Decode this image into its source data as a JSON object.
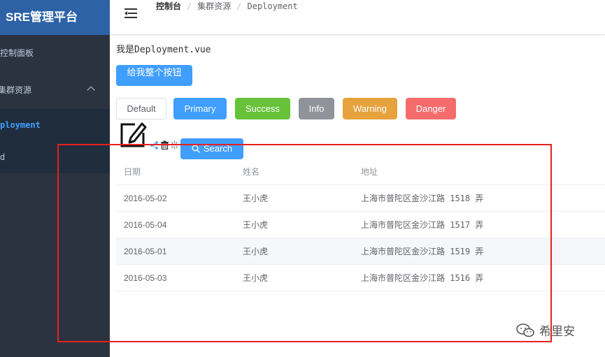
{
  "sidebar": {
    "logo": "SRE管理平台",
    "items": [
      {
        "label": "控制面板"
      },
      {
        "label": "集群资源"
      },
      {
        "label": "ployment"
      },
      {
        "label": "d"
      }
    ]
  },
  "header": {
    "breadcrumb": [
      "控制台",
      "集群资源",
      "Deployment"
    ]
  },
  "main": {
    "intro": "我是Deployment.vue",
    "custom_button": "给我整个按钮",
    "buttons": [
      "Default",
      "Primary",
      "Success",
      "Info",
      "Warning",
      "Danger"
    ],
    "search_button": "Search",
    "icons": [
      "edit-icon",
      "share-icon",
      "delete-icon",
      "loading-icon",
      "search-icon"
    ]
  },
  "table": {
    "columns": [
      "日期",
      "姓名",
      "地址"
    ],
    "rows": [
      [
        "2016-05-02",
        "王小虎",
        "上海市普陀区金沙江路 1518 弄"
      ],
      [
        "2016-05-04",
        "王小虎",
        "上海市普陀区金沙江路 1517 弄"
      ],
      [
        "2016-05-01",
        "王小虎",
        "上海市普陀区金沙江路 1519 弄"
      ],
      [
        "2016-05-03",
        "王小虎",
        "上海市普陀区金沙江路 1516 弄"
      ]
    ]
  },
  "watermark": "希里安",
  "colors": {
    "sidebar_bg": "#2b3340",
    "logo_bg": "#2d62a7",
    "active_menu": "#409eff",
    "primary": "#409eff",
    "success": "#67c23a",
    "info": "#909399",
    "warning": "#e6a23c",
    "danger": "#f56c6c",
    "annotation_frame": "#e8201e"
  }
}
